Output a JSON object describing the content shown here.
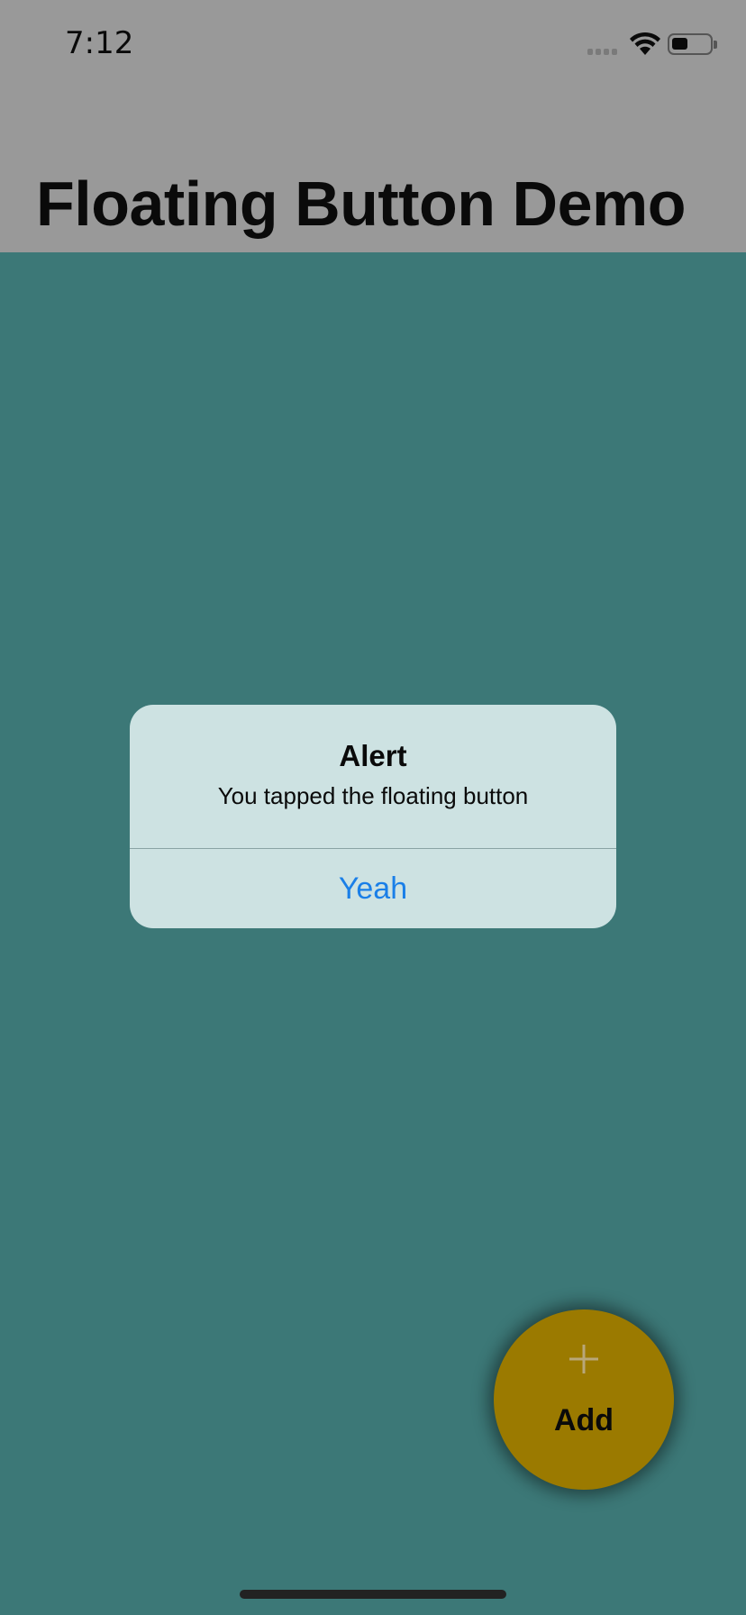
{
  "status_bar": {
    "time": "7:12"
  },
  "header": {
    "title": "Floating Button Demo"
  },
  "alert": {
    "title": "Alert",
    "message": "You tapped the floating button",
    "button_label": "Yeah"
  },
  "fab": {
    "icon": "plus-icon",
    "label": "Add"
  },
  "colors": {
    "background": "#3c7877",
    "header": "#999999",
    "alert_background": "#cde2e2",
    "alert_button": "#1a7fe8",
    "fab": "#9b7a00"
  }
}
